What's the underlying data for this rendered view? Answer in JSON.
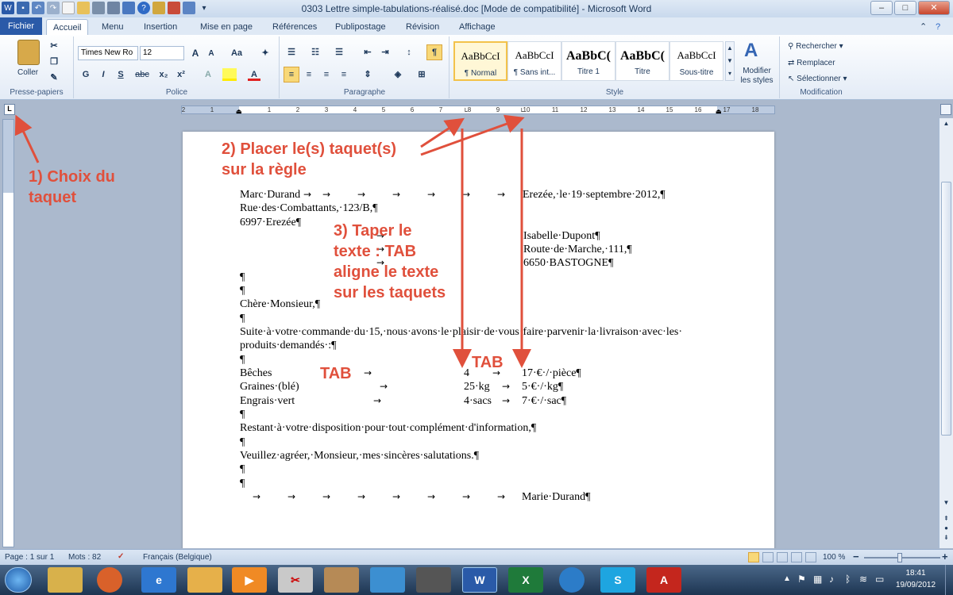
{
  "window": {
    "title": "0303 Lettre simple-tabulations-réalisé.doc [Mode de compatibilité] - Microsoft Word",
    "btn_min": "–",
    "btn_max": "□",
    "btn_close": "✕"
  },
  "tabs": [
    "Fichier",
    "Accueil",
    "Menu",
    "Insertion",
    "Mise en page",
    "Références",
    "Publipostage",
    "Révision",
    "Affichage"
  ],
  "ribbon": {
    "clipboard": {
      "paste": "Coller",
      "label": "Presse-papiers"
    },
    "font": {
      "name": "Times New Ro",
      "size": "12",
      "label": "Police",
      "bold": "G",
      "italic": "I",
      "underline": "S",
      "strike": "abc",
      "sub": "x₂",
      "sup": "x²",
      "grow": "A",
      "shrink": "A",
      "case": "Aa",
      "color": "A"
    },
    "paragraph": {
      "label": "Paragraphe",
      "pilcrow": "¶"
    },
    "styles": {
      "label": "Style",
      "items": [
        {
          "preview": "AaBbCcI",
          "name": "¶ Normal"
        },
        {
          "preview": "AaBbCcI",
          "name": "¶ Sans int..."
        },
        {
          "preview": "AaBbC(",
          "name": "Titre 1"
        },
        {
          "preview": "AaBbC(",
          "name": "Titre"
        },
        {
          "preview": "AaBbCcI",
          "name": "Sous-titre"
        }
      ],
      "modify": "Modifier les styles"
    },
    "editing": {
      "label": "Modification",
      "find": "Rechercher",
      "replace": "Remplacer",
      "select": "Sélectionner"
    }
  },
  "ruler": {
    "tab_selector": "L",
    "ticks": [
      "2",
      "1",
      "1",
      "2",
      "3",
      "4",
      "5",
      "6",
      "7",
      "8",
      "9",
      "10",
      "11",
      "12",
      "13",
      "14",
      "15",
      "16",
      "17",
      "18"
    ]
  },
  "document": {
    "lines": [
      {
        "id": "l1",
        "text": "Marc·Durand"
      },
      {
        "id": "l1r",
        "text": "Erezée,·le·19·septembre·2012,¶"
      },
      {
        "id": "l2",
        "text": "Rue·des·Combattants,·123/B,¶"
      },
      {
        "id": "l3",
        "text": "6997·Erezée¶"
      },
      {
        "id": "l4",
        "text": "Isabelle·Dupont¶"
      },
      {
        "id": "l5",
        "text": "Route·de·Marche,·111,¶"
      },
      {
        "id": "l6",
        "text": "6650·BASTOGNE¶"
      },
      {
        "id": "p1",
        "text": "¶"
      },
      {
        "id": "p2",
        "text": "¶"
      },
      {
        "id": "l7",
        "text": "Chère·Monsieur,¶"
      },
      {
        "id": "p3",
        "text": "¶"
      },
      {
        "id": "l8",
        "text": "Suite·à·votre·commande·du·15,·nous·avons·le·plaisir·de·vous·faire·parvenir·la·livraison·avec·les·"
      },
      {
        "id": "l9",
        "text": "produits·demandés·:¶"
      },
      {
        "id": "p4",
        "text": "¶"
      },
      {
        "id": "r1a",
        "text": "Bêches"
      },
      {
        "id": "r1b",
        "text": "4"
      },
      {
        "id": "r1c",
        "text": "17·€·/·pièce¶"
      },
      {
        "id": "r2a",
        "text": "Graines·(blé)"
      },
      {
        "id": "r2b",
        "text": "25·kg"
      },
      {
        "id": "r2c",
        "text": "5·€·/·kg¶"
      },
      {
        "id": "r3a",
        "text": "Engrais·vert"
      },
      {
        "id": "r3b",
        "text": "4·sacs"
      },
      {
        "id": "r3c",
        "text": "7·€·/·sac¶"
      },
      {
        "id": "p5",
        "text": "¶"
      },
      {
        "id": "l10",
        "text": "Restant·à·votre·disposition·pour·tout·complément·d'information,¶"
      },
      {
        "id": "p6",
        "text": "¶"
      },
      {
        "id": "l11",
        "text": "Veuillez·agréer,·Monsieur,·mes·sincères·salutations.¶"
      },
      {
        "id": "p7",
        "text": "¶"
      },
      {
        "id": "p8",
        "text": "¶"
      },
      {
        "id": "l12",
        "text": "Marie·Durand¶"
      }
    ],
    "tab_arrow": "→"
  },
  "annotations": {
    "a1": [
      "1) Choix du",
      "taquet"
    ],
    "a2": [
      "2) Placer le(s) taquet(s)",
      "sur la règle"
    ],
    "a3": [
      "3) Taper le",
      "texte : TAB",
      "aligne le texte",
      "sur les taquets"
    ],
    "tab1": "TAB",
    "tab2": "TAB"
  },
  "statusbar": {
    "page": "Page : 1 sur 1",
    "words": "Mots : 82",
    "lang": "Français (Belgique)",
    "zoom": "100 %",
    "zoom_minus": "−",
    "zoom_plus": "+"
  },
  "taskbar": {
    "time": "18:41",
    "date": "19/09/2012",
    "apps": [
      "Explorateur",
      "Firefox",
      "Internet Explorer",
      "Outlook",
      "Media",
      "Paint",
      "Dessin",
      "Notes",
      "Sci",
      "Word",
      "Excel",
      "Edge",
      "Skype",
      "Acrobat"
    ]
  },
  "colors": {
    "annotation": "#e0503c",
    "file_tab": "#2a5aa8"
  }
}
